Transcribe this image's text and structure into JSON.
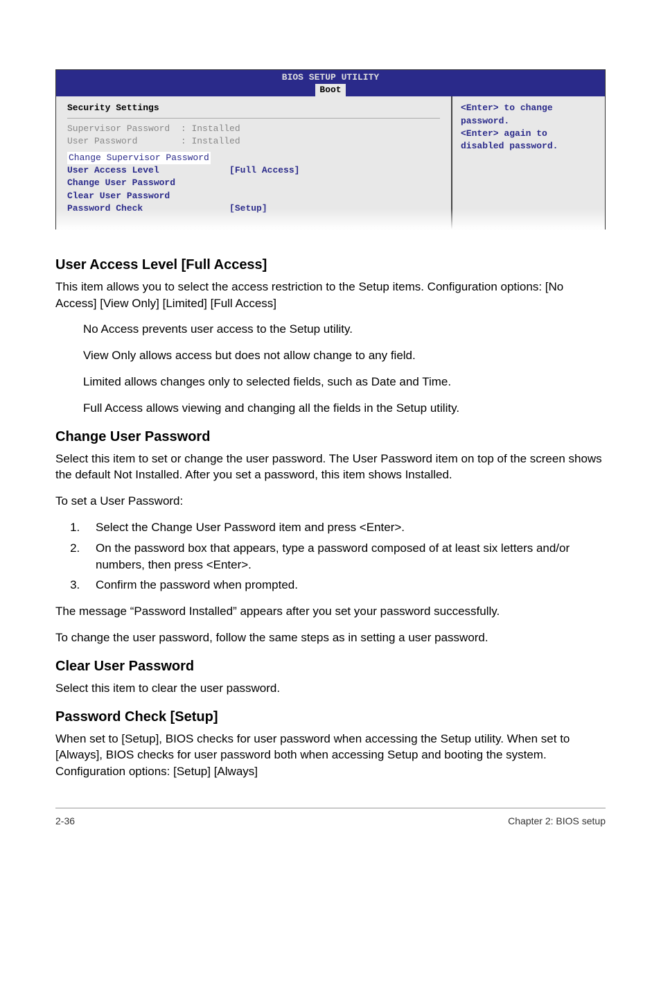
{
  "bios": {
    "title": "BIOS SETUP UTILITY",
    "tab": "Boot",
    "section": "Security Settings",
    "supervisor_label": "Supervisor Password",
    "supervisor_value": ": Installed",
    "user_pw_label": "User Password",
    "user_pw_value": ": Installed",
    "change_super": "Change Supervisor Password",
    "ual_label": "User Access Level",
    "ual_value": "[Full Access]",
    "change_user": "Change User Password",
    "clear_user": "Clear User Password",
    "pw_check_label": "Password Check",
    "pw_check_value": "[Setup]",
    "help1": "<Enter> to change",
    "help2": "password.",
    "help3": "<Enter> again to",
    "help4": "disabled password."
  },
  "sections": {
    "ual_heading": "User Access Level [Full Access]",
    "ual_p1": "This item allows you to select the access restriction to the Setup items. Configuration options: [No Access] [View Only] [Limited] [Full Access]",
    "ual_opt1": "No Access prevents user access to the Setup utility.",
    "ual_opt2": "View Only allows access but does not allow change to any field.",
    "ual_opt3": "Limited allows changes only to selected fields, such as Date and Time.",
    "ual_opt4": "Full Access allows viewing and changing all the fields in the Setup utility.",
    "cup_heading": "Change User Password",
    "cup_p1": "Select this item to set or change the user password. The User Password item on top of the screen shows the default Not Installed. After you set a password, this item shows Installed.",
    "cup_p2": "To set a User Password:",
    "cup_li1": "Select the Change User Password item and press <Enter>.",
    "cup_li2": "On the password box that appears, type a password composed of at least six letters and/or numbers, then press <Enter>.",
    "cup_li3": "Confirm the password when prompted.",
    "cup_p3": "The message “Password Installed” appears after you set your password successfully.",
    "cup_p4": "To change the user password, follow the same steps as in setting a user password.",
    "clup_heading": "Clear User Password",
    "clup_p1": "Select this item to clear the user password.",
    "pc_heading": "Password Check [Setup]",
    "pc_p1": "When set to [Setup], BIOS checks for user password when accessing the Setup utility. When set to [Always], BIOS checks for user password both when accessing Setup and booting the system. Configuration options: [Setup] [Always]"
  },
  "footer": {
    "page": "2-36",
    "chapter": "Chapter 2: BIOS setup"
  }
}
